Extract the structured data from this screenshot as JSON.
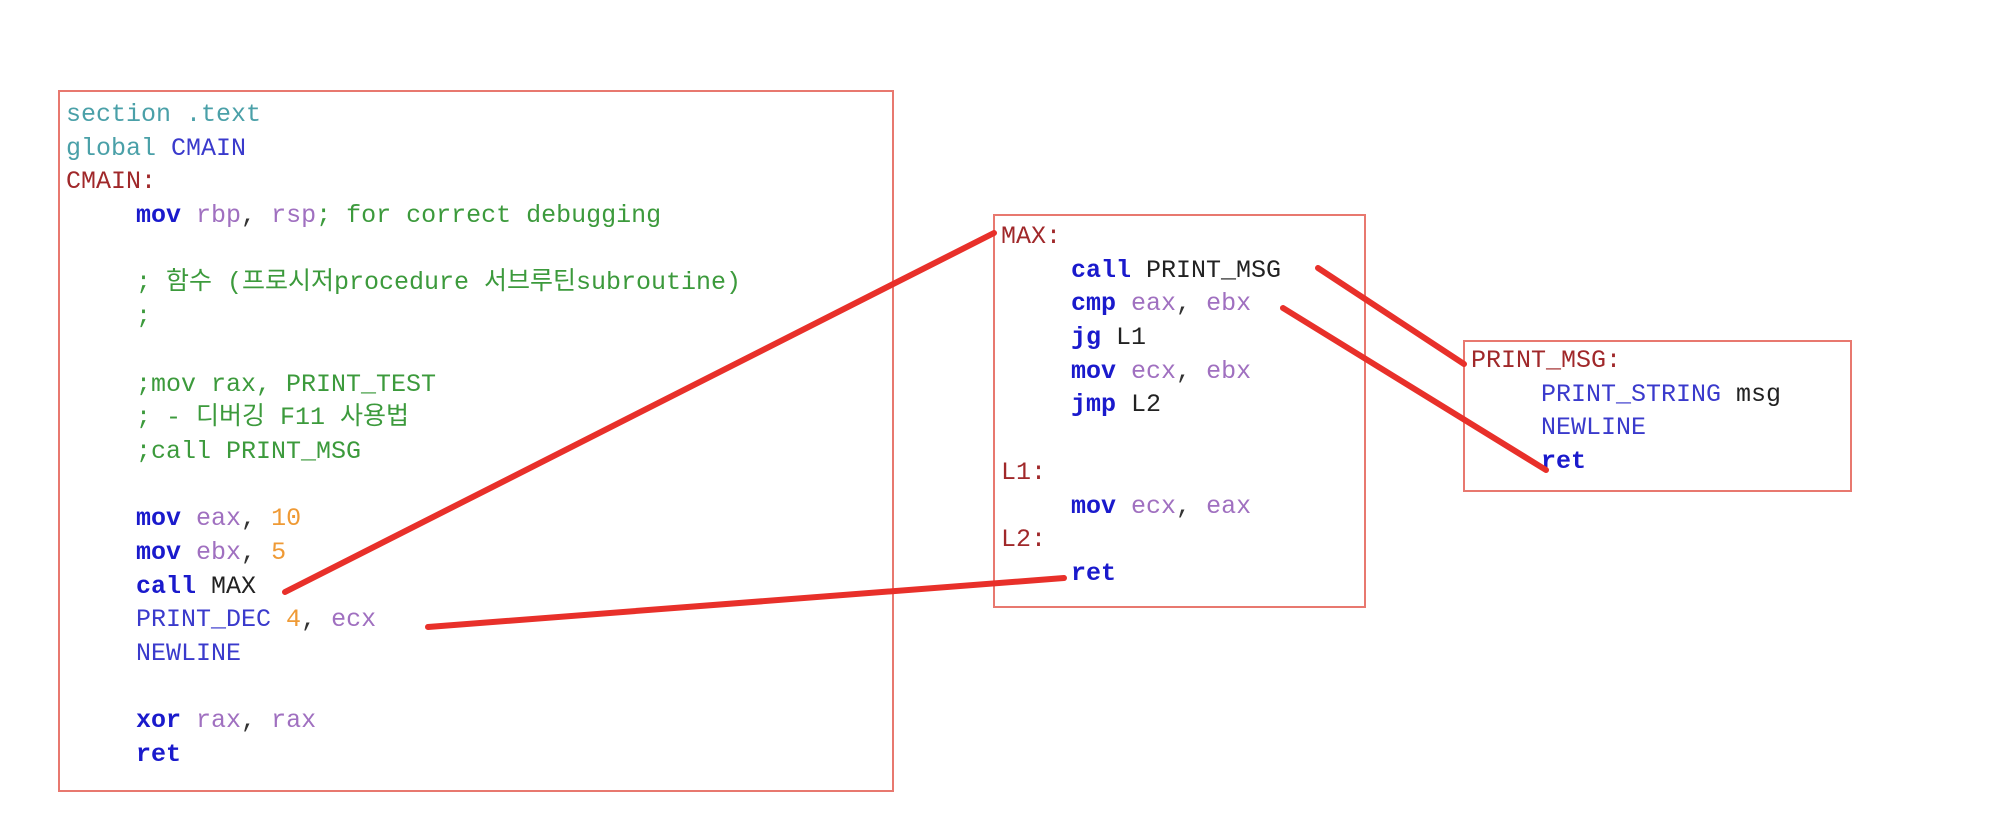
{
  "main": {
    "l1_a": "section",
    "l1_b": ".text",
    "l2_a": "global",
    "l2_b": "CMAIN",
    "l3": "CMAIN:",
    "l4_kw": "mov",
    "l4_r1": "rbp",
    "l4_c1": ",",
    "l4_r2": "rsp",
    "l4_cm": "; for correct debugging",
    "l6": "; 함수 (프로시저procedure 서브루틴subroutine)",
    "l7": ";",
    "l9": ";mov rax, PRINT_TEST",
    "l10": "; - 디버깅 F11 사용법",
    "l11": ";call PRINT_MSG",
    "l13_kw": "mov",
    "l13_r": "eax",
    "l13_c": ",",
    "l13_n": "10",
    "l14_kw": "mov",
    "l14_r": "ebx",
    "l14_c": ",",
    "l14_n": "5",
    "l15_kw": "call",
    "l15_id": "MAX",
    "l16_m": "PRINT_DEC",
    "l16_n": "4",
    "l16_c": ",",
    "l16_r": "ecx",
    "l17": "NEWLINE",
    "l19_kw": "xor",
    "l19_r1": "rax",
    "l19_c": ",",
    "l19_r2": "rax",
    "l20": "ret"
  },
  "max": {
    "l1": "MAX:",
    "l2_kw": "call",
    "l2_id": "PRINT_MSG",
    "l3_kw": "cmp",
    "l3_r1": "eax",
    "l3_c": ",",
    "l3_r2": "ebx",
    "l4_kw": "jg",
    "l4_id": "L1",
    "l5_kw": "mov",
    "l5_r1": "ecx",
    "l5_c": ",",
    "l5_r2": "ebx",
    "l6_kw": "jmp",
    "l6_id": "L2",
    "l8": "L1:",
    "l9_kw": "mov",
    "l9_r1": "ecx",
    "l9_c": ",",
    "l9_r2": "eax",
    "l10": "L2:",
    "l11": "ret"
  },
  "print_msg": {
    "l1": "PRINT_MSG:",
    "l2_m": "PRINT_STRING",
    "l2_id": "msg",
    "l3": "NEWLINE",
    "l4": "ret"
  },
  "colors": {
    "box_border": "#e8786f",
    "connector": "#e8302a",
    "keyword": "#1a1acc",
    "register": "#a070c0",
    "number": "#ef9a35",
    "comment": "#3c9a3c",
    "label": "#a0282a",
    "directive": "#4aa0a8",
    "macro": "#3a3acc"
  }
}
